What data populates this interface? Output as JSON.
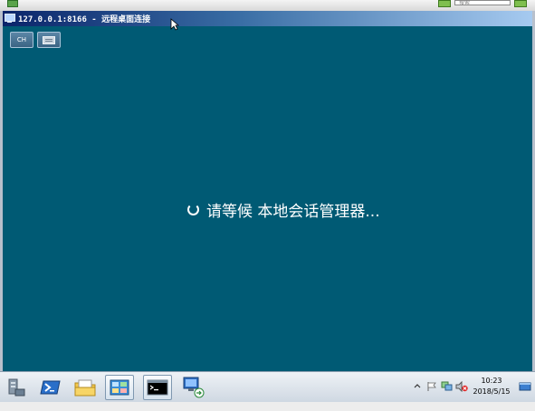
{
  "window": {
    "title": "127.0.0.1:8166 - 远程桌面连接"
  },
  "toolbar": {
    "lang_label": "CH",
    "keyboard_icon": "keyboard-icon"
  },
  "host": {
    "search_placeholder": "搜索"
  },
  "remote": {
    "status_text": "请等候 本地会话管理器...",
    "background_color": "#005a74"
  },
  "taskbar": {
    "items": [
      {
        "name": "server-manager-icon"
      },
      {
        "name": "powershell-icon"
      },
      {
        "name": "file-explorer-icon"
      },
      {
        "name": "control-panel-icon"
      },
      {
        "name": "command-prompt-icon"
      },
      {
        "name": "remote-desktop-icon"
      }
    ],
    "clock_time": "10:23",
    "clock_date": "2018/5/15"
  }
}
